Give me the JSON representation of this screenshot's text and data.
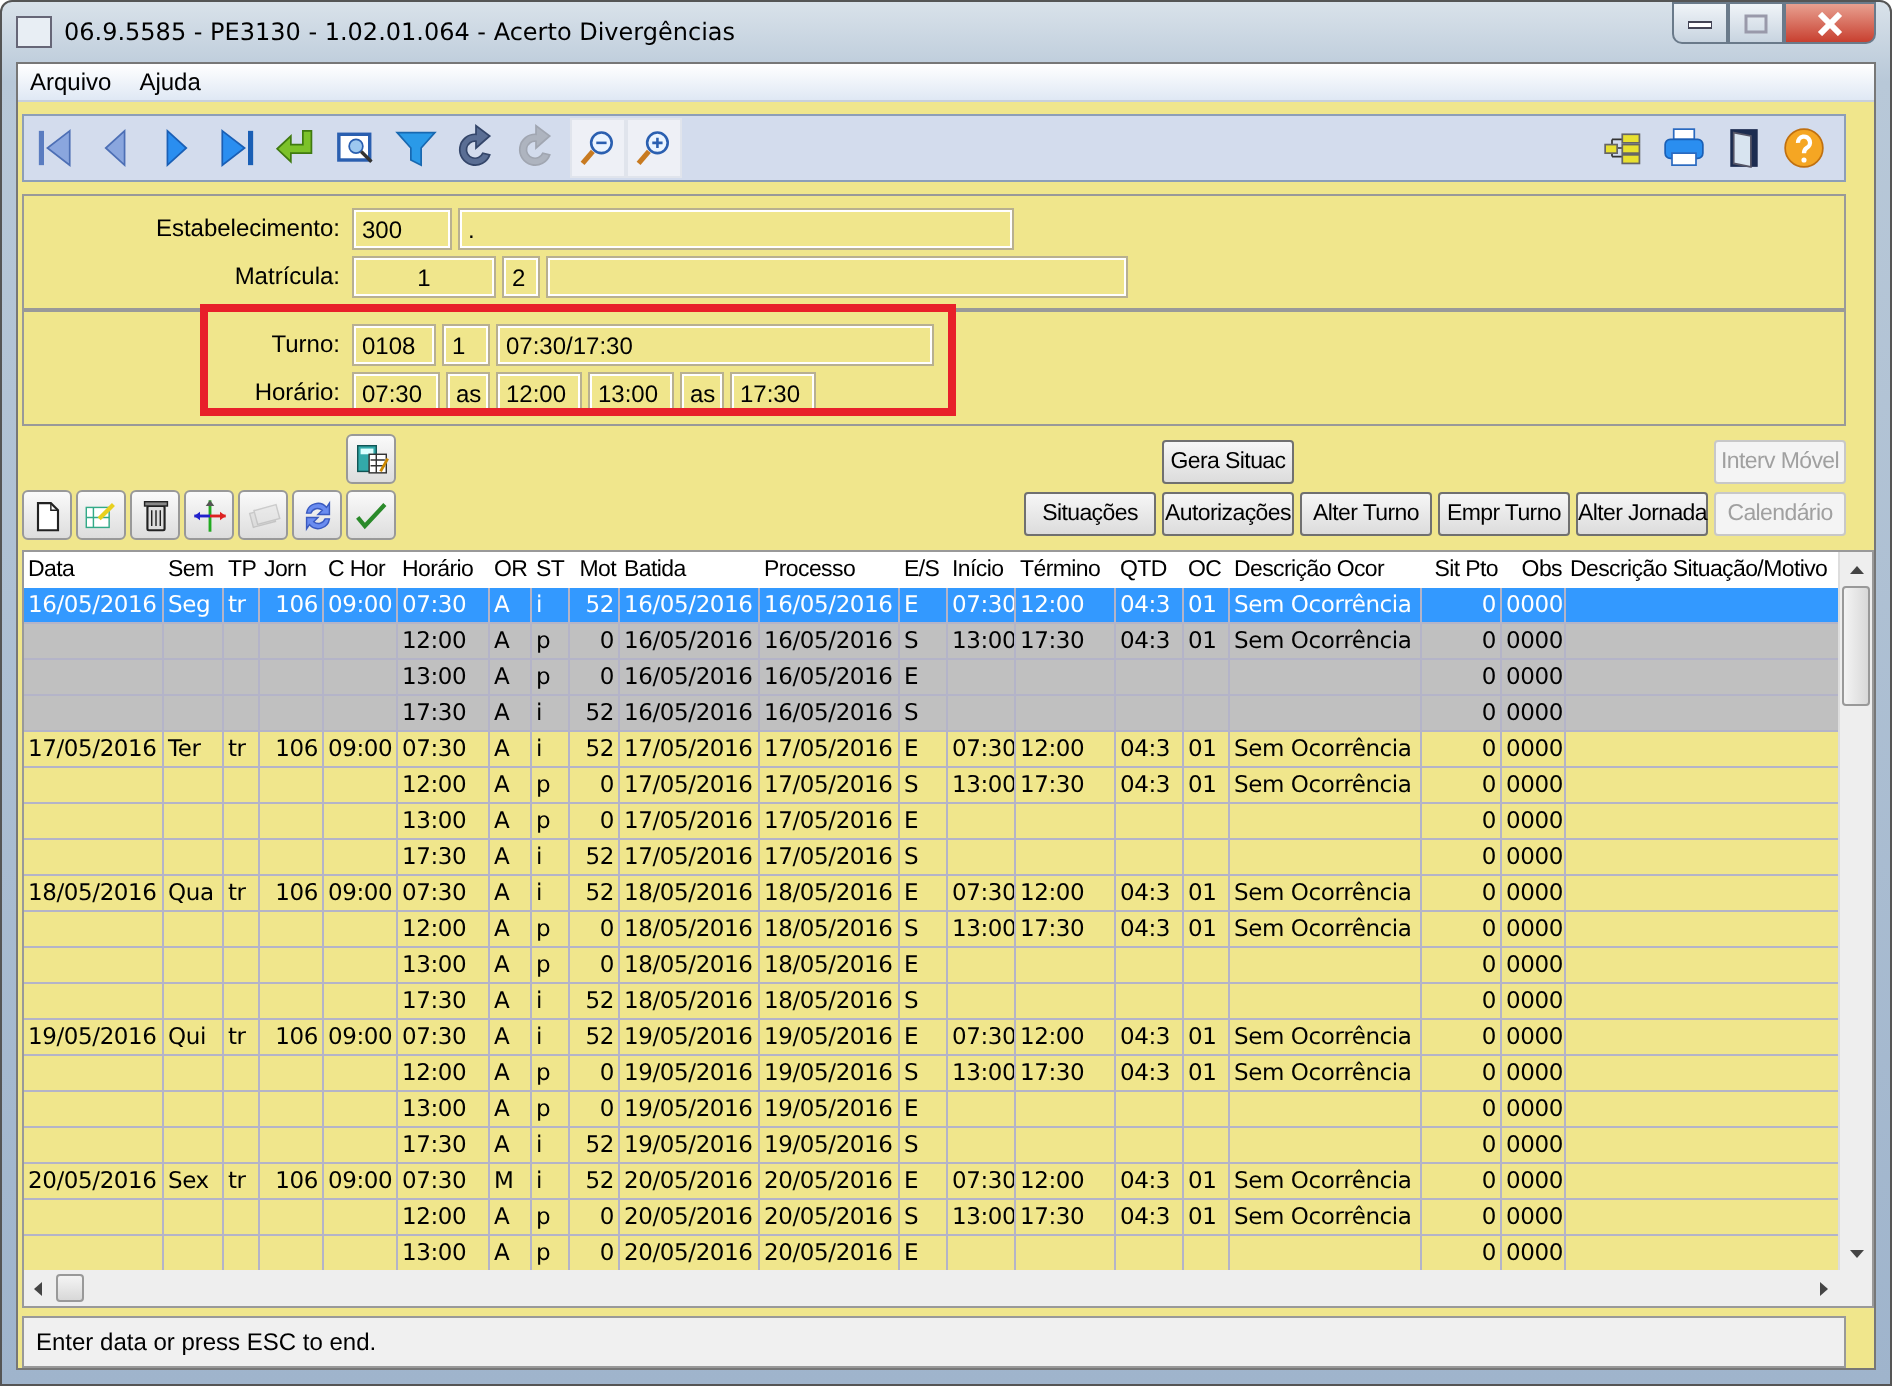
{
  "window": {
    "title": "06.9.5585 - PE3130 - 1.02.01.064 - Acerto Divergências"
  },
  "menu": [
    {
      "label": "Arquivo"
    },
    {
      "label": "Ajuda"
    }
  ],
  "toolbar": {
    "left": [
      {
        "kind": "first",
        "disabled": false
      },
      {
        "kind": "prev",
        "disabled": false
      },
      {
        "kind": "next",
        "disabled": false
      },
      {
        "kind": "last",
        "disabled": false
      },
      {
        "kind": "enter",
        "disabled": false
      },
      {
        "kind": "preview",
        "disabled": false
      },
      {
        "kind": "filter",
        "disabled": false
      },
      {
        "kind": "redo",
        "disabled": false
      },
      {
        "kind": "redo",
        "disabled": true
      },
      {
        "kind": "zoom-out",
        "disabled": false
      },
      {
        "kind": "zoom-in",
        "disabled": false
      }
    ],
    "right": [
      {
        "kind": "tree",
        "disabled": false
      },
      {
        "kind": "print",
        "disabled": false
      },
      {
        "kind": "exit",
        "disabled": false
      },
      {
        "kind": "help",
        "disabled": false
      }
    ]
  },
  "form": {
    "sections": [
      {
        "highlighted": false,
        "rows": [
          {
            "label": "Estabelecimento:",
            "boxes": [
              {
                "value": "300"
              },
              {
                "value": "."
              }
            ]
          },
          {
            "label": "Matrícula:",
            "boxes": [
              {
                "value": "1"
              },
              {
                "value": "2"
              },
              {
                "kind": "blank"
              }
            ]
          }
        ]
      },
      {
        "highlighted": true,
        "rows": [
          {
            "label": "Turno:",
            "boxes": [
              {
                "value": "0108"
              },
              {
                "value": "1"
              },
              {
                "value": "07:30/17:30"
              }
            ]
          },
          {
            "label": "Horário:",
            "boxes": [
              {
                "value": "07:30"
              },
              {
                "value": "as"
              },
              {
                "value": "12:00"
              },
              {
                "value": "13:00"
              },
              {
                "value": "as"
              },
              {
                "value": "17:30"
              }
            ]
          }
        ]
      }
    ]
  },
  "tools": {
    "top": [
      {
        "kind": "calculator",
        "disabled": false
      }
    ],
    "bottom": [
      {
        "kind": "new",
        "disabled": false
      },
      {
        "kind": "edit",
        "disabled": false
      },
      {
        "kind": "delete",
        "disabled": false
      },
      {
        "kind": "move",
        "disabled": false
      },
      {
        "kind": "batch",
        "disabled": true
      },
      {
        "kind": "refresh",
        "disabled": false
      },
      {
        "kind": "confirm",
        "disabled": false
      }
    ]
  },
  "buttons": {
    "top": [
      {
        "label": "Gera Situac",
        "disabled": false
      },
      {
        "label": "Interv Móvel",
        "disabled": true
      }
    ],
    "bottom": [
      {
        "label": "Situações",
        "disabled": false
      },
      {
        "label": "Autorizações",
        "disabled": false
      },
      {
        "label": "Alter Turno",
        "disabled": false
      },
      {
        "label": "Empr Turno",
        "disabled": false
      },
      {
        "label": "Alter Jornada",
        "disabled": false
      },
      {
        "label": "Calendário",
        "disabled": true
      }
    ]
  },
  "table": {
    "columns": [
      "Data",
      "Sem",
      "TP",
      "Jorn",
      "C Hor",
      "Horário",
      "OR",
      "ST",
      "Mot",
      "Batida",
      "Processo",
      "E/S",
      "Início",
      "Término",
      "QTD",
      "OC",
      "Descrição Ocor",
      "Sit Pto",
      "Obs",
      "Descrição Situação/Motivo"
    ],
    "rows": [
      {
        "selected": true,
        "highlighted": false,
        "data": "16/05/2016",
        "sem": "Seg",
        "tp": "tr",
        "jorn": "106",
        "c_hor": "09:00",
        "horario": "07:30",
        "or": "A",
        "st": "i",
        "mot": "52",
        "batida": "16/05/2016",
        "processo": "16/05/2016",
        "e_s": "E",
        "inicio": "07:30",
        "termino": "12:00",
        "qtd": "04:3",
        "oc": "01",
        "descricao_ocor": "Sem Ocorrência",
        "sit_pto": "0",
        "obs": "0000"
      },
      {
        "selected": false,
        "highlighted": true,
        "horario": "12:00",
        "or": "A",
        "st": "p",
        "mot": "0",
        "batida": "16/05/2016",
        "processo": "16/05/2016",
        "e_s": "S",
        "inicio": "13:00",
        "termino": "17:30",
        "qtd": "04:3",
        "oc": "01",
        "descricao_ocor": "Sem Ocorrência",
        "sit_pto": "0",
        "obs": "0000"
      },
      {
        "selected": false,
        "highlighted": true,
        "horario": "13:00",
        "or": "A",
        "st": "p",
        "mot": "0",
        "batida": "16/05/2016",
        "processo": "16/05/2016",
        "e_s": "E",
        "sit_pto": "0",
        "obs": "0000"
      },
      {
        "selected": false,
        "highlighted": true,
        "horario": "17:30",
        "or": "A",
        "st": "i",
        "mot": "52",
        "batida": "16/05/2016",
        "processo": "16/05/2016",
        "e_s": "S",
        "sit_pto": "0",
        "obs": "0000"
      },
      {
        "selected": false,
        "highlighted": false,
        "data": "17/05/2016",
        "sem": "Ter",
        "tp": "tr",
        "jorn": "106",
        "c_hor": "09:00",
        "horario": "07:30",
        "or": "A",
        "st": "i",
        "mot": "52",
        "batida": "17/05/2016",
        "processo": "17/05/2016",
        "e_s": "E",
        "inicio": "07:30",
        "termino": "12:00",
        "qtd": "04:3",
        "oc": "01",
        "descricao_ocor": "Sem Ocorrência",
        "sit_pto": "0",
        "obs": "0000"
      },
      {
        "selected": false,
        "highlighted": false,
        "horario": "12:00",
        "or": "A",
        "st": "p",
        "mot": "0",
        "batida": "17/05/2016",
        "processo": "17/05/2016",
        "e_s": "S",
        "inicio": "13:00",
        "termino": "17:30",
        "qtd": "04:3",
        "oc": "01",
        "descricao_ocor": "Sem Ocorrência",
        "sit_pto": "0",
        "obs": "0000"
      },
      {
        "selected": false,
        "highlighted": false,
        "horario": "13:00",
        "or": "A",
        "st": "p",
        "mot": "0",
        "batida": "17/05/2016",
        "processo": "17/05/2016",
        "e_s": "E",
        "sit_pto": "0",
        "obs": "0000"
      },
      {
        "selected": false,
        "highlighted": false,
        "horario": "17:30",
        "or": "A",
        "st": "i",
        "mot": "52",
        "batida": "17/05/2016",
        "processo": "17/05/2016",
        "e_s": "S",
        "sit_pto": "0",
        "obs": "0000"
      },
      {
        "selected": false,
        "highlighted": false,
        "data": "18/05/2016",
        "sem": "Qua",
        "tp": "tr",
        "jorn": "106",
        "c_hor": "09:00",
        "horario": "07:30",
        "or": "A",
        "st": "i",
        "mot": "52",
        "batida": "18/05/2016",
        "processo": "18/05/2016",
        "e_s": "E",
        "inicio": "07:30",
        "termino": "12:00",
        "qtd": "04:3",
        "oc": "01",
        "descricao_ocor": "Sem Ocorrência",
        "sit_pto": "0",
        "obs": "0000"
      },
      {
        "selected": false,
        "highlighted": false,
        "horario": "12:00",
        "or": "A",
        "st": "p",
        "mot": "0",
        "batida": "18/05/2016",
        "processo": "18/05/2016",
        "e_s": "S",
        "inicio": "13:00",
        "termino": "17:30",
        "qtd": "04:3",
        "oc": "01",
        "descricao_ocor": "Sem Ocorrência",
        "sit_pto": "0",
        "obs": "0000"
      },
      {
        "selected": false,
        "highlighted": false,
        "horario": "13:00",
        "or": "A",
        "st": "p",
        "mot": "0",
        "batida": "18/05/2016",
        "processo": "18/05/2016",
        "e_s": "E",
        "sit_pto": "0",
        "obs": "0000"
      },
      {
        "selected": false,
        "highlighted": false,
        "horario": "17:30",
        "or": "A",
        "st": "i",
        "mot": "52",
        "batida": "18/05/2016",
        "processo": "18/05/2016",
        "e_s": "S",
        "sit_pto": "0",
        "obs": "0000"
      },
      {
        "selected": false,
        "highlighted": false,
        "data": "19/05/2016",
        "sem": "Qui",
        "tp": "tr",
        "jorn": "106",
        "c_hor": "09:00",
        "horario": "07:30",
        "or": "A",
        "st": "i",
        "mot": "52",
        "batida": "19/05/2016",
        "processo": "19/05/2016",
        "e_s": "E",
        "inicio": "07:30",
        "termino": "12:00",
        "qtd": "04:3",
        "oc": "01",
        "descricao_ocor": "Sem Ocorrência",
        "sit_pto": "0",
        "obs": "0000"
      },
      {
        "selected": false,
        "highlighted": false,
        "horario": "12:00",
        "or": "A",
        "st": "p",
        "mot": "0",
        "batida": "19/05/2016",
        "processo": "19/05/2016",
        "e_s": "S",
        "inicio": "13:00",
        "termino": "17:30",
        "qtd": "04:3",
        "oc": "01",
        "descricao_ocor": "Sem Ocorrência",
        "sit_pto": "0",
        "obs": "0000"
      },
      {
        "selected": false,
        "highlighted": false,
        "horario": "13:00",
        "or": "A",
        "st": "p",
        "mot": "0",
        "batida": "19/05/2016",
        "processo": "19/05/2016",
        "e_s": "E",
        "sit_pto": "0",
        "obs": "0000"
      },
      {
        "selected": false,
        "highlighted": false,
        "horario": "17:30",
        "or": "A",
        "st": "i",
        "mot": "52",
        "batida": "19/05/2016",
        "processo": "19/05/2016",
        "e_s": "S",
        "sit_pto": "0",
        "obs": "0000"
      },
      {
        "selected": false,
        "highlighted": false,
        "data": "20/05/2016",
        "sem": "Sex",
        "tp": "tr",
        "jorn": "106",
        "c_hor": "09:00",
        "horario": "07:30",
        "or": "M",
        "st": "i",
        "mot": "52",
        "batida": "20/05/2016",
        "processo": "20/05/2016",
        "e_s": "E",
        "inicio": "07:30",
        "termino": "12:00",
        "qtd": "04:3",
        "oc": "01",
        "descricao_ocor": "Sem Ocorrência",
        "sit_pto": "0",
        "obs": "0000"
      },
      {
        "selected": false,
        "highlighted": false,
        "horario": "12:00",
        "or": "A",
        "st": "p",
        "mot": "0",
        "batida": "20/05/2016",
        "processo": "20/05/2016",
        "e_s": "S",
        "inicio": "13:00",
        "termino": "17:30",
        "qtd": "04:3",
        "oc": "01",
        "descricao_ocor": "Sem Ocorrência",
        "sit_pto": "0",
        "obs": "0000"
      },
      {
        "selected": false,
        "highlighted": false,
        "horario": "13:00",
        "or": "A",
        "st": "p",
        "mot": "0",
        "batida": "20/05/2016",
        "processo": "20/05/2016",
        "e_s": "E",
        "sit_pto": "0",
        "obs": "0000"
      }
    ]
  },
  "status_bar": {
    "text": "Enter data or press ESC to end."
  }
}
